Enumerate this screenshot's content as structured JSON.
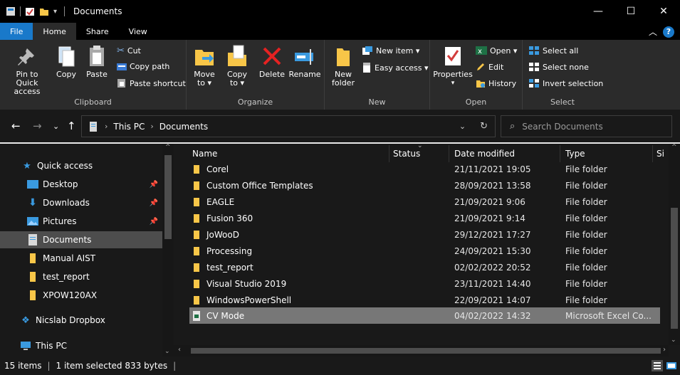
{
  "window": {
    "title": "Documents",
    "minimize": "—",
    "maximize": "☐",
    "close": "✕"
  },
  "ribbon_tabs": [
    {
      "label": "File"
    },
    {
      "label": "Home"
    },
    {
      "label": "Share"
    },
    {
      "label": "View"
    }
  ],
  "ribbon": {
    "clipboard": {
      "label": "Clipboard",
      "pin": "Pin to Quick access",
      "copy": "Copy",
      "paste": "Paste",
      "cut": "Cut",
      "copy_path": "Copy path",
      "paste_shortcut": "Paste shortcut"
    },
    "organize": {
      "label": "Organize",
      "move_to": "Move to ▾",
      "copy_to": "Copy to ▾",
      "delete": "Delete",
      "rename": "Rename"
    },
    "new": {
      "label": "New",
      "new_folder": "New folder",
      "new_item": "New item ▾",
      "easy_access": "Easy access ▾"
    },
    "open": {
      "label": "Open",
      "properties": "Properties",
      "open": "Open ▾",
      "edit": "Edit",
      "history": "History"
    },
    "select": {
      "label": "Select",
      "select_all": "Select all",
      "select_none": "Select none",
      "invert": "Invert selection"
    }
  },
  "address": {
    "segments": [
      "This PC",
      "Documents"
    ],
    "search_placeholder": "Search Documents"
  },
  "nav_pane": [
    {
      "label": "Quick access",
      "icon": "star-icon",
      "pinned": false
    },
    {
      "label": "Desktop",
      "icon": "desktop-icon",
      "pinned": true
    },
    {
      "label": "Downloads",
      "icon": "download-icon",
      "pinned": true
    },
    {
      "label": "Pictures",
      "icon": "pictures-icon",
      "pinned": true
    },
    {
      "label": "Documents",
      "icon": "documents-icon",
      "pinned": false
    },
    {
      "label": "Manual AIST",
      "icon": "folder-icon",
      "pinned": false
    },
    {
      "label": "test_report",
      "icon": "folder-icon",
      "pinned": false
    },
    {
      "label": "XPOW120AX",
      "icon": "folder-icon",
      "pinned": false
    },
    {
      "label": "Nicslab Dropbox",
      "icon": "dropbox-icon",
      "pinned": false
    },
    {
      "label": "This PC",
      "icon": "computer-icon",
      "pinned": false
    }
  ],
  "columns": {
    "name": "Name",
    "status": "Status",
    "date": "Date modified",
    "type": "Type",
    "size": "Si"
  },
  "files": [
    {
      "name": "Corel",
      "date": "21/11/2021 19:05",
      "type": "File folder"
    },
    {
      "name": "Custom Office Templates",
      "date": "28/09/2021 13:58",
      "type": "File folder"
    },
    {
      "name": "EAGLE",
      "date": "21/09/2021 9:06",
      "type": "File folder"
    },
    {
      "name": "Fusion 360",
      "date": "21/09/2021 9:14",
      "type": "File folder"
    },
    {
      "name": "JoWooD",
      "date": "29/12/2021 17:27",
      "type": "File folder"
    },
    {
      "name": "Processing",
      "date": "24/09/2021 15:30",
      "type": "File folder"
    },
    {
      "name": "test_report",
      "date": "02/02/2022 20:52",
      "type": "File folder"
    },
    {
      "name": "Visual Studio 2019",
      "date": "23/11/2021 14:40",
      "type": "File folder"
    },
    {
      "name": "WindowsPowerShell",
      "date": "22/09/2021 14:07",
      "type": "File folder"
    },
    {
      "name": "CV Mode",
      "date": "04/02/2022 14:32",
      "type": "Microsoft Excel Co..."
    }
  ],
  "status": {
    "items": "15 items",
    "selected": "1 item selected  833 bytes"
  },
  "colors": {
    "accent": "#1979ca",
    "folder": "#f8c648",
    "selected_row": "#777777"
  }
}
